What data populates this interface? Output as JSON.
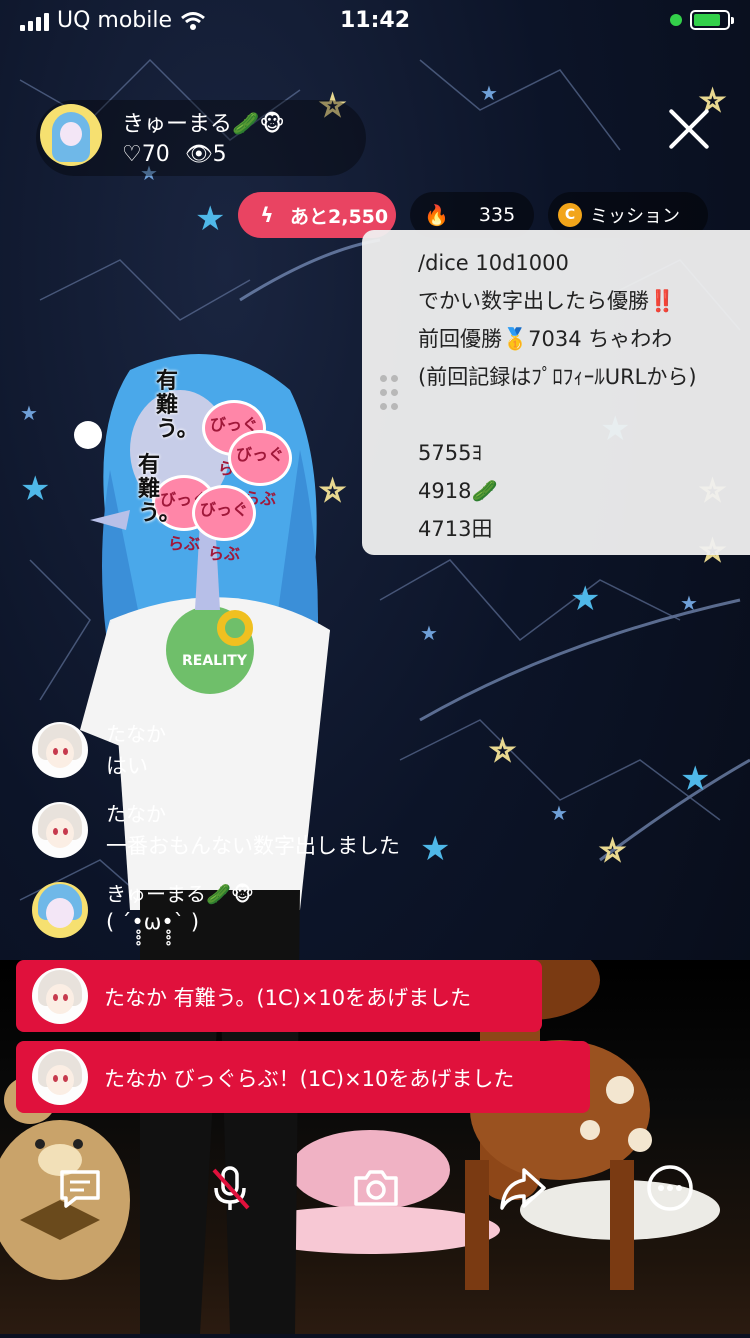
{
  "status_bar": {
    "carrier": "UQ mobile",
    "time": "11:42"
  },
  "streamer": {
    "name": "きゅーまる🥒🐵",
    "likes": "♡70",
    "viewers": "👁5"
  },
  "pills": {
    "remaining": "あと2,550",
    "points": "335",
    "mission": "ミッション",
    "coin_letter": "C"
  },
  "note": {
    "lines": [
      "/dice 10d1000",
      "でかい数字出したら優勝‼️",
      "前回優勝🥇7034 ちゃわわ",
      "(前回記録はﾌﾟﾛﾌｨｰﾙURLから)",
      "",
      "5755ﾖ",
      "4918🥒",
      "4713田"
    ]
  },
  "stamps": [
    "有難う。",
    "有難う。",
    "有難う。",
    "びっぐらぶ",
    "びっぐらぶ"
  ],
  "comments": [
    {
      "name": "たなか",
      "text": "はい"
    },
    {
      "name": "たなか",
      "text": "一番おもんない数字出しました"
    },
    {
      "name": "きゅーまる🥒🐵",
      "text": "( ´•̥̥̥ω•̥̥̥` )"
    }
  ],
  "gifts": [
    {
      "text": "たなか 有難う。(1C)×10をあげました"
    },
    {
      "text": "たなか びっぐらぶ！(1C)×10をあげました"
    }
  ],
  "toolbar": [
    "comment-icon",
    "mic-muted-icon",
    "camera-icon",
    "share-icon",
    "more-icon"
  ],
  "colors": {
    "gift_red": "#e0113c",
    "pill_red": "#e94462",
    "coin": "#f2a51a",
    "status_green": "#33d04a"
  }
}
